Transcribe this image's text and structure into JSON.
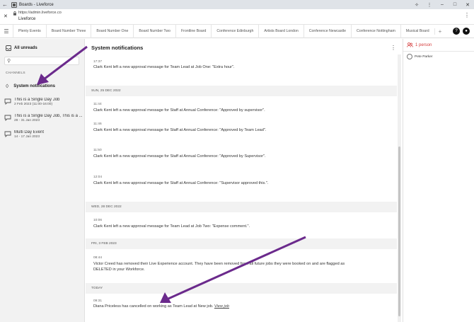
{
  "window": {
    "title": "Boards - Liveforce",
    "url": "https://admin.liveforce.co",
    "site_name": "Liveforce"
  },
  "tabs": [
    {
      "label": "Plenty Events"
    },
    {
      "label": "Board Number Three"
    },
    {
      "label": "Board Number One"
    },
    {
      "label": "Board Number Two"
    },
    {
      "label": "Frontline Board"
    },
    {
      "label": "Conference Edinburgh"
    },
    {
      "label": "Artists Board London"
    },
    {
      "label": "Conference Newcastle"
    },
    {
      "label": "Conference Nottingham"
    },
    {
      "label": "Musical Board"
    }
  ],
  "header_icons": {
    "help": "?",
    "notifications": "bell-icon"
  },
  "sidebar": {
    "all_unreads": "All unreads",
    "search_placeholder": "",
    "channels_heading": "CHANNELS",
    "system_notifications": "System notifications",
    "channels": [
      {
        "name": "This is a Single Day Job",
        "date": "2 Feb 2023 (11:00-16:00)"
      },
      {
        "name": "This is a Single Day Job, This is a ...",
        "date": "28 - 31 Jan 2023"
      },
      {
        "name": "Multi Day Event",
        "date": "14 - 17 Jan 2023"
      }
    ]
  },
  "main": {
    "title": "System notifications",
    "dates": {
      "d1": "SUN, 25 DEC 2022",
      "d2": "WED, 28 DEC 2022",
      "d3": "FRI, 3 FEB 2023",
      "d4": "TODAY"
    },
    "messages": [
      {
        "time": "17:37",
        "text": "Clark Kent left a new approval message for Team Lead at Job One: \"Extra hour\"."
      },
      {
        "time": "11:44",
        "text": "Clark Kent left a new approval message for Staff at Annual Conference: \"Approved by supervisor\"."
      },
      {
        "time": "11:46",
        "text": "Clark Kent left a new approval message for Staff at Annual Conference: \"Approved by Team Lead\"."
      },
      {
        "time": "11:50",
        "text": "Clark Kent left a new approval message for Staff at Annual Conference: \"Approved by Supervisor\"."
      },
      {
        "time": "12:04",
        "text": "Clark Kent left a new approval message for Staff at Annual Conference: \"Supervisor approved this.\"."
      },
      {
        "time": "10:06",
        "text": "Clark Kent left a new approval message for Team Lead at Job Two: \"Expense comment.\"."
      },
      {
        "time": "08:44",
        "text": "Victor Creed has removed their Live Experience account. They have been removed from all future jobs they were booked on and are flagged as DELETED in your Workforce."
      },
      {
        "time": "09:31",
        "text": "Diana Priceless has cancelled on working as Team Lead at New job.",
        "link": "View job"
      }
    ]
  },
  "right_panel": {
    "count_label": "1 person",
    "person_name": "Pete Parker"
  },
  "colors": {
    "accent": "#d43c3c",
    "arrow": "#6b2a8c",
    "sidebar_bg": "#f2f2f2"
  }
}
